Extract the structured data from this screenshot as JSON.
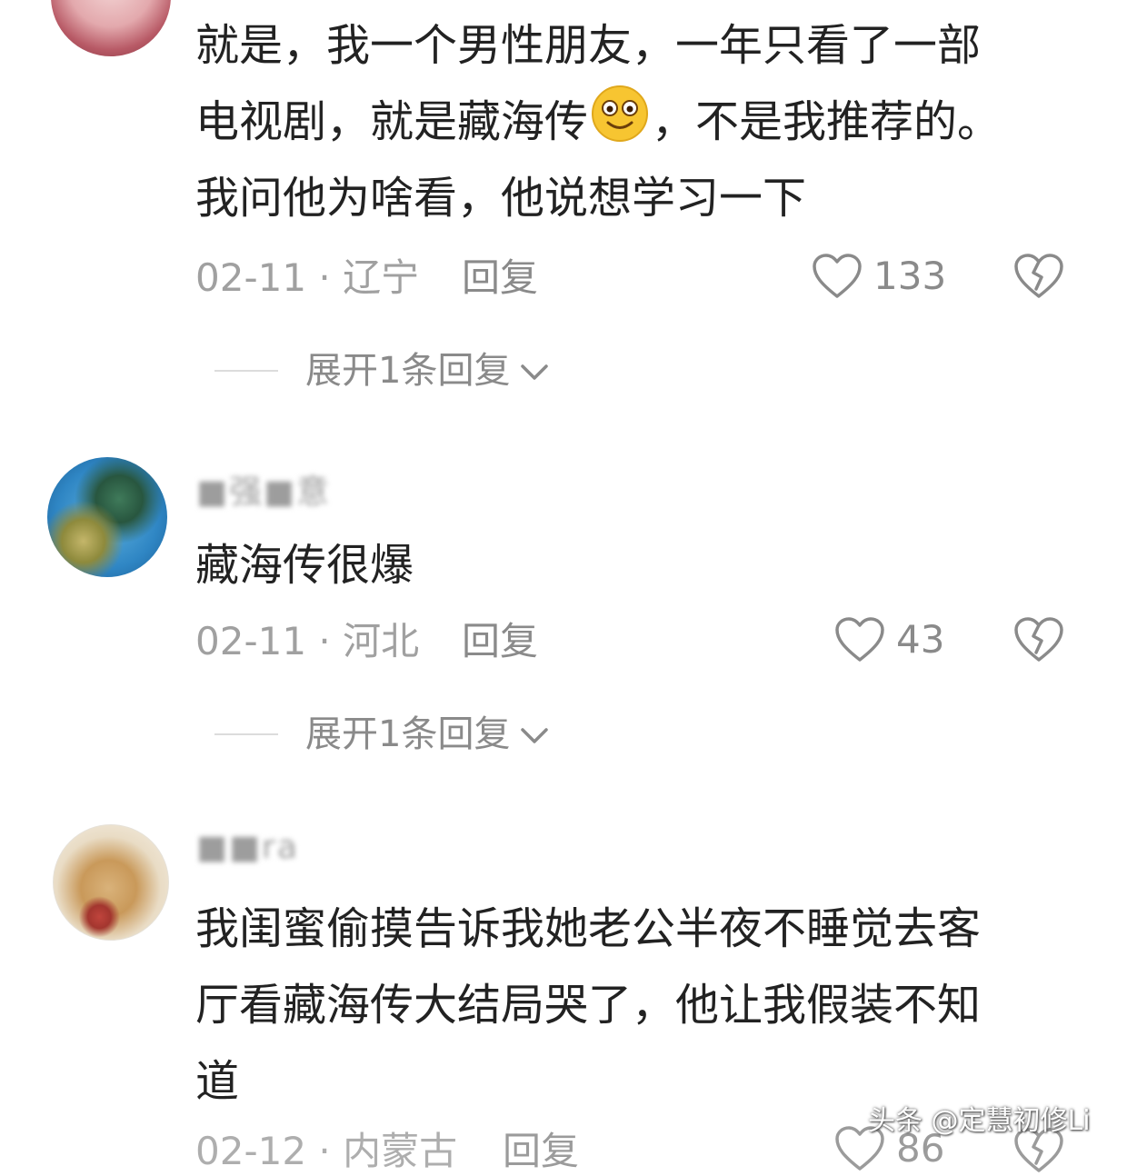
{
  "comments": [
    {
      "content_parts": [
        "就是，我一个男性朋友，一年只看了一部\n电视剧，就是藏海传",
        "，不是我推荐的。\n我问他为啥看，他说想学习一下"
      ],
      "emoji": "smile-emoji",
      "date_location": "02-11 · 辽宁",
      "reply_label": "回复",
      "likes": "133",
      "expand_label": "展开1条回复"
    },
    {
      "username": "■强■意",
      "content": "藏海传很爆",
      "date_location": "02-11 · 河北",
      "reply_label": "回复",
      "likes": "43",
      "expand_label": "展开1条回复"
    },
    {
      "username": "■■ra",
      "content": "我闺蜜偷摸告诉我她老公半夜不睡觉去客\n厅看藏海传大结局哭了，他让我假装不知\n道",
      "date_location": "02-12 · 内蒙古",
      "reply_label": "回复",
      "likes": "86"
    }
  ],
  "watermark": "头条 @定慧初修Li",
  "icons": {
    "like": "heart-outline-icon",
    "dislike": "broken-heart-icon",
    "expand": "chevron-down-icon"
  },
  "colors": {
    "text": "#222222",
    "meta": "#a0a0a0",
    "action": "#8a8a8a"
  }
}
